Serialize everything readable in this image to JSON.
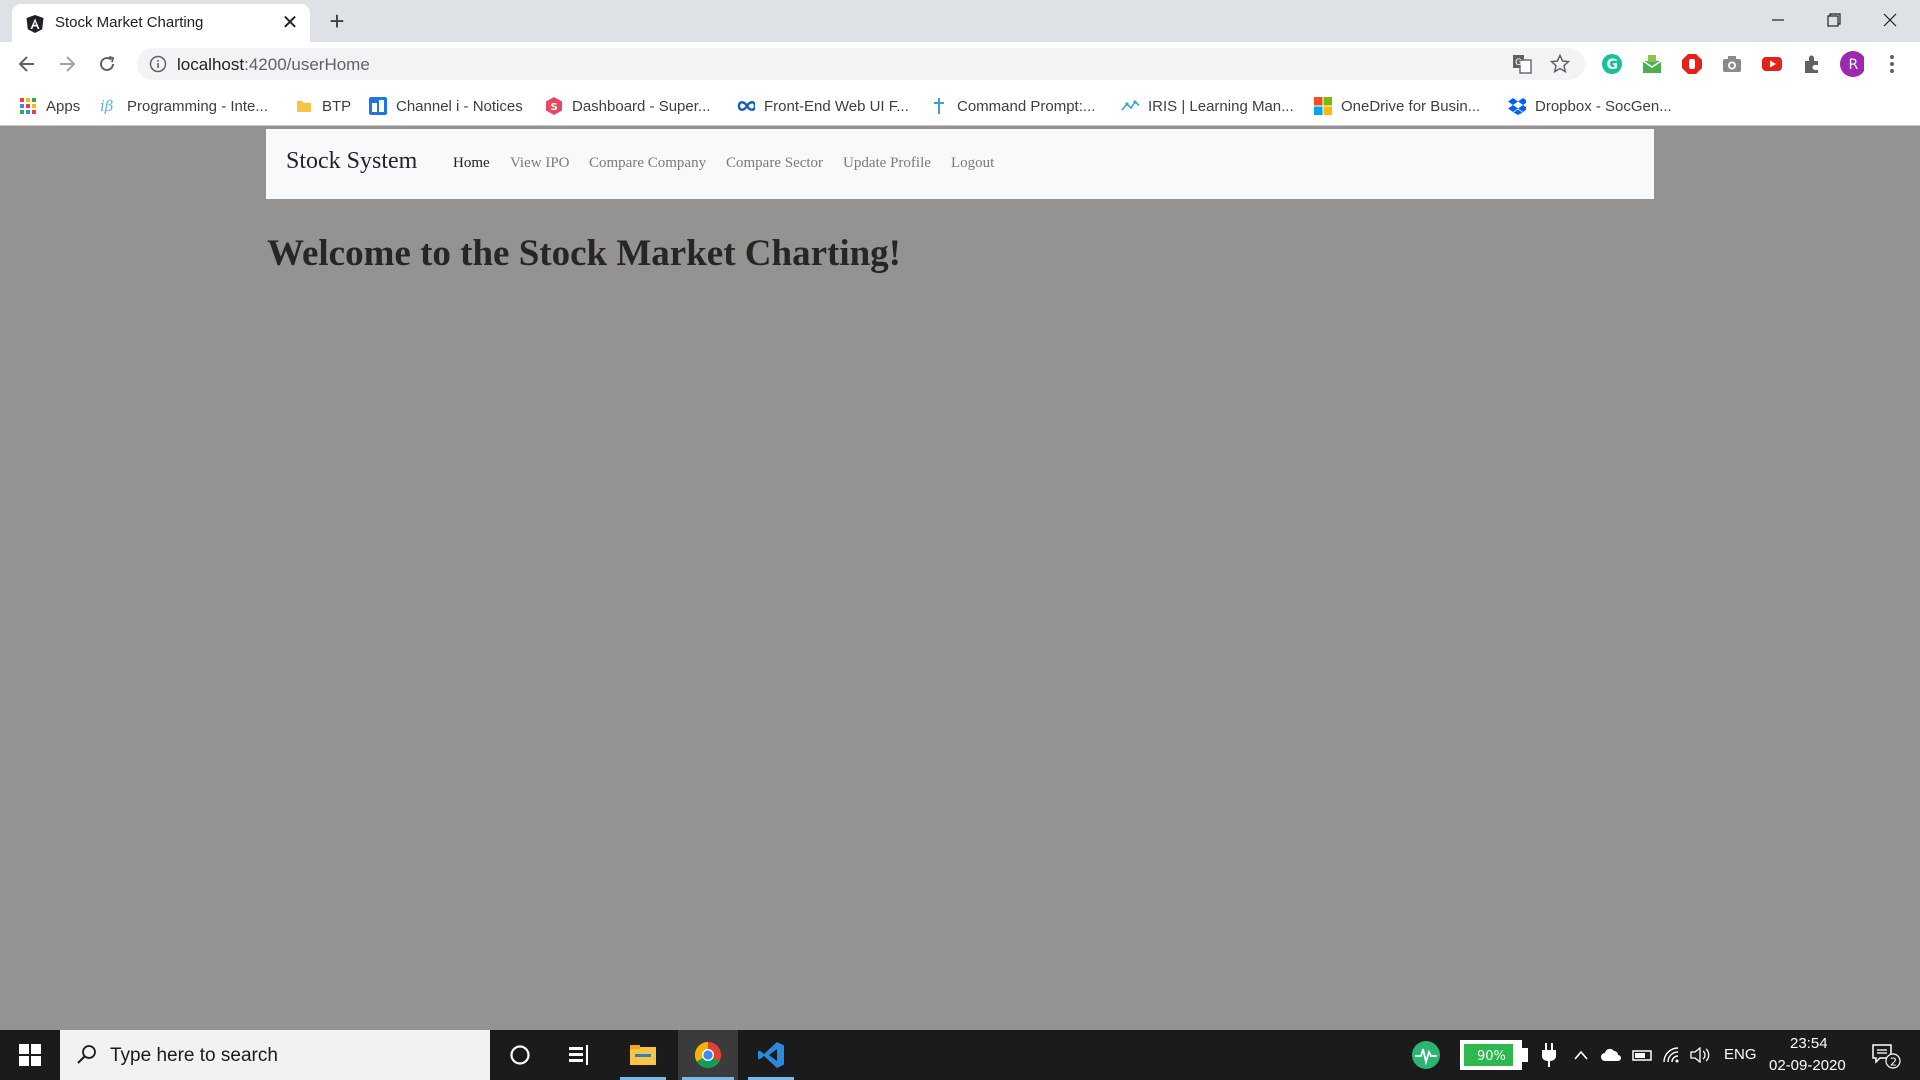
{
  "browser": {
    "tab_title": "Stock Market Charting",
    "tab_close_glyph": "✕",
    "new_tab_glyph": "+",
    "url_host": "localhost",
    "url_path": ":4200/userHome",
    "bookmarks": [
      {
        "label": "Apps",
        "icon": "apps-grid-icon"
      },
      {
        "label": "Programming - Inte...",
        "icon": "ib-logo-icon"
      },
      {
        "label": "BTP",
        "icon": "folder-icon"
      },
      {
        "label": "Channel i - Notices",
        "icon": "channel-i-icon"
      },
      {
        "label": "Dashboard - Super...",
        "icon": "supabase-icon"
      },
      {
        "label": "Front-End Web UI F...",
        "icon": "infinity-icon"
      },
      {
        "label": "Command Prompt:...",
        "icon": "pin-icon"
      },
      {
        "label": "IRIS | Learning Man...",
        "icon": "iris-icon"
      },
      {
        "label": "OneDrive for Busin...",
        "icon": "microsoft-logo-icon"
      },
      {
        "label": "Dropbox - SocGen...",
        "icon": "dropbox-icon"
      }
    ],
    "profile_initial": "R",
    "colors": {
      "tabstrip": "#dee1e6",
      "omnibox": "#f1f3f4"
    }
  },
  "app": {
    "brand": "Stock System",
    "nav": [
      {
        "label": "Home",
        "active": true
      },
      {
        "label": "View IPO",
        "active": false
      },
      {
        "label": "Compare Company",
        "active": false
      },
      {
        "label": "Compare Sector",
        "active": false
      },
      {
        "label": "Update Profile",
        "active": false
      },
      {
        "label": "Logout",
        "active": false
      }
    ],
    "welcome": "Welcome to the Stock Market Charting!",
    "colors": {
      "background": "#949391",
      "navbar": "#f8f9fa"
    }
  },
  "taskbar": {
    "search_placeholder": "Type here to search",
    "battery": "90%",
    "language": "ENG",
    "time": "23:54",
    "date": "02-09-2020",
    "notifications": "2"
  }
}
